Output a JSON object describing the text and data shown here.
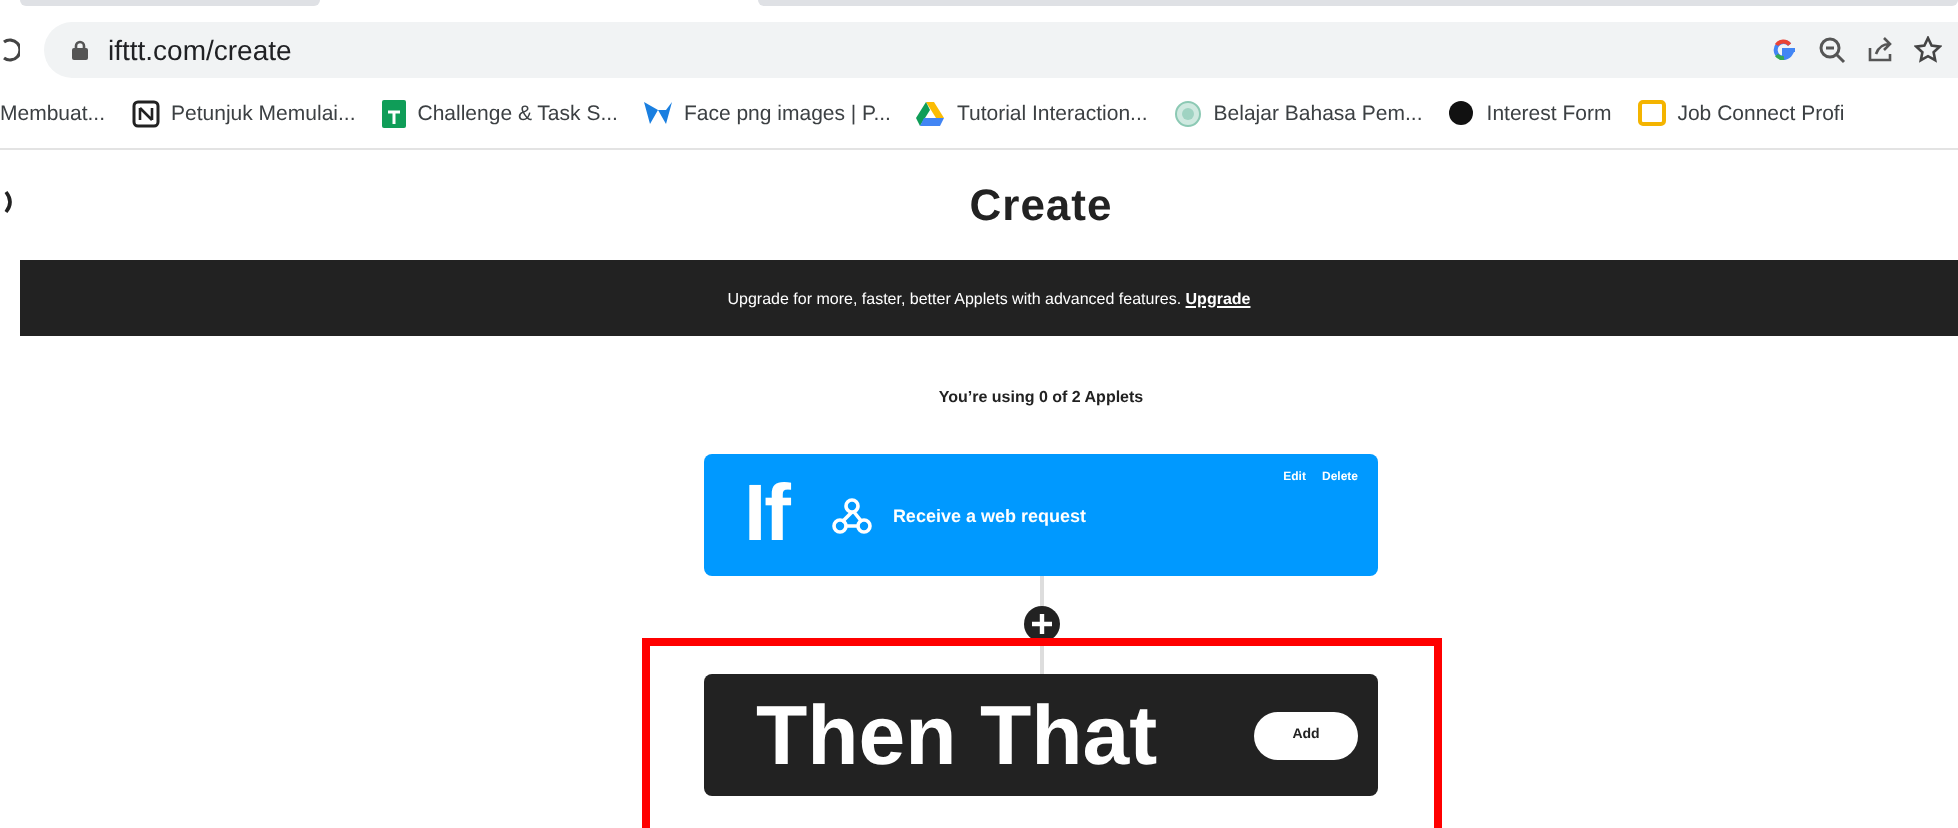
{
  "address_bar": {
    "url": "ifttt.com/create"
  },
  "bookmarks": [
    {
      "label": "Membuat...",
      "kind": "none"
    },
    {
      "label": "Petunjuk Memulai...",
      "kind": "notion"
    },
    {
      "label": "Challenge & Task S...",
      "kind": "sheets"
    },
    {
      "label": "Face png images | P...",
      "kind": "w"
    },
    {
      "label": "Tutorial Interaction...",
      "kind": "drive"
    },
    {
      "label": "Belajar Bahasa Pem...",
      "kind": "globe"
    },
    {
      "label": "Interest Form",
      "kind": "dot"
    },
    {
      "label": "Job Connect Profi",
      "kind": "slides"
    }
  ],
  "page": {
    "title": "Create",
    "banner": {
      "text": "Upgrade for more, faster, better Applets with advanced features.",
      "link": "Upgrade"
    },
    "usage": "You’re using 0 of 2 Applets"
  },
  "if_card": {
    "keyword": "If",
    "trigger": "Receive a web request",
    "actions": [
      "Edit",
      "Delete"
    ]
  },
  "then_card": {
    "keyword": "Then That",
    "button": "Add",
    "highlighted": true
  }
}
